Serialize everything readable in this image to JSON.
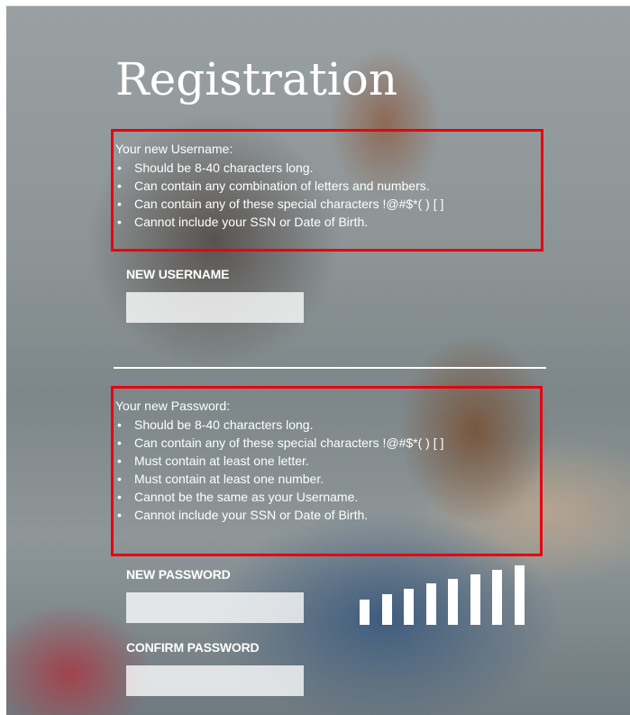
{
  "page": {
    "title": "Registration"
  },
  "username_requirements": {
    "heading": "Your new Username:",
    "items": [
      "Should be 8-40 characters long.",
      "Can contain any combination of letters and numbers.",
      "Can contain any of these special characters !@#$*( ) [ ]",
      "Cannot include your SSN or Date of Birth."
    ]
  },
  "username_field": {
    "label": "NEW USERNAME",
    "value": ""
  },
  "password_requirements": {
    "heading": "Your new Password:",
    "items": [
      "Should be 8-40 characters long.",
      "Can contain any of these special characters !@#$*( ) [ ]",
      "Must contain at least one letter.",
      "Must contain at least one number.",
      "Cannot be the same as your Username.",
      "Cannot include your SSN or Date of Birth."
    ]
  },
  "password_field": {
    "label": "NEW PASSWORD",
    "value": ""
  },
  "confirm_password_field": {
    "label": "CONFIRM PASSWORD",
    "value": ""
  },
  "password_strength_meter": {
    "bar_count": 8,
    "level": 0
  },
  "colors": {
    "highlight_border": "#e8000f",
    "text": "#ffffff"
  }
}
